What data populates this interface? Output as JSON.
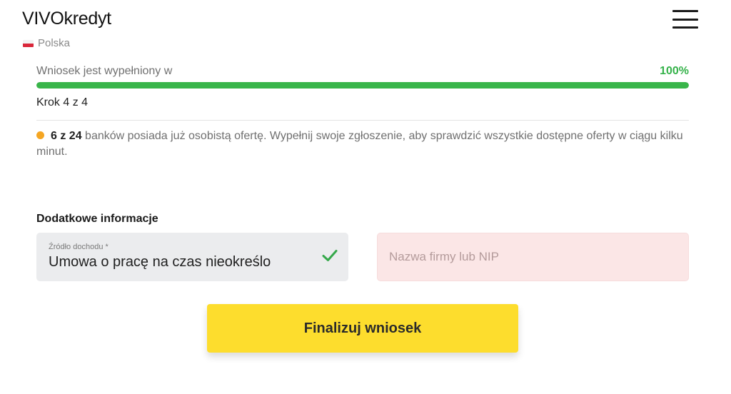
{
  "header": {
    "logo_text": "VIVOkredyt",
    "region": "Polska",
    "menu_icon": "hamburger-icon"
  },
  "progress": {
    "label": "Wniosek jest wypełniony w",
    "percent_text": "100%",
    "value": 1.0,
    "color": "#39b54a",
    "step_text": "Krok 4 z 4"
  },
  "notice": {
    "count": "6 z 24",
    "text": " banków posiada już osobistą ofertę. Wypełnij swoje zgłoszenie, aby sprawdzić wszystkie dostępne oferty w ciągu kilku minut.",
    "dot_color": "#f5a623"
  },
  "form": {
    "section_title": "Dodatkowe informacje",
    "income_source": {
      "label": "Źródło dochodu *",
      "value": "Umowa o pracę na czas nieokreślo",
      "icon": "check-icon"
    },
    "company": {
      "placeholder": "Nazwa firmy lub NIP",
      "value": ""
    },
    "submit_label": "Finalizuj wniosek",
    "submit_color": "#fddd2d"
  }
}
